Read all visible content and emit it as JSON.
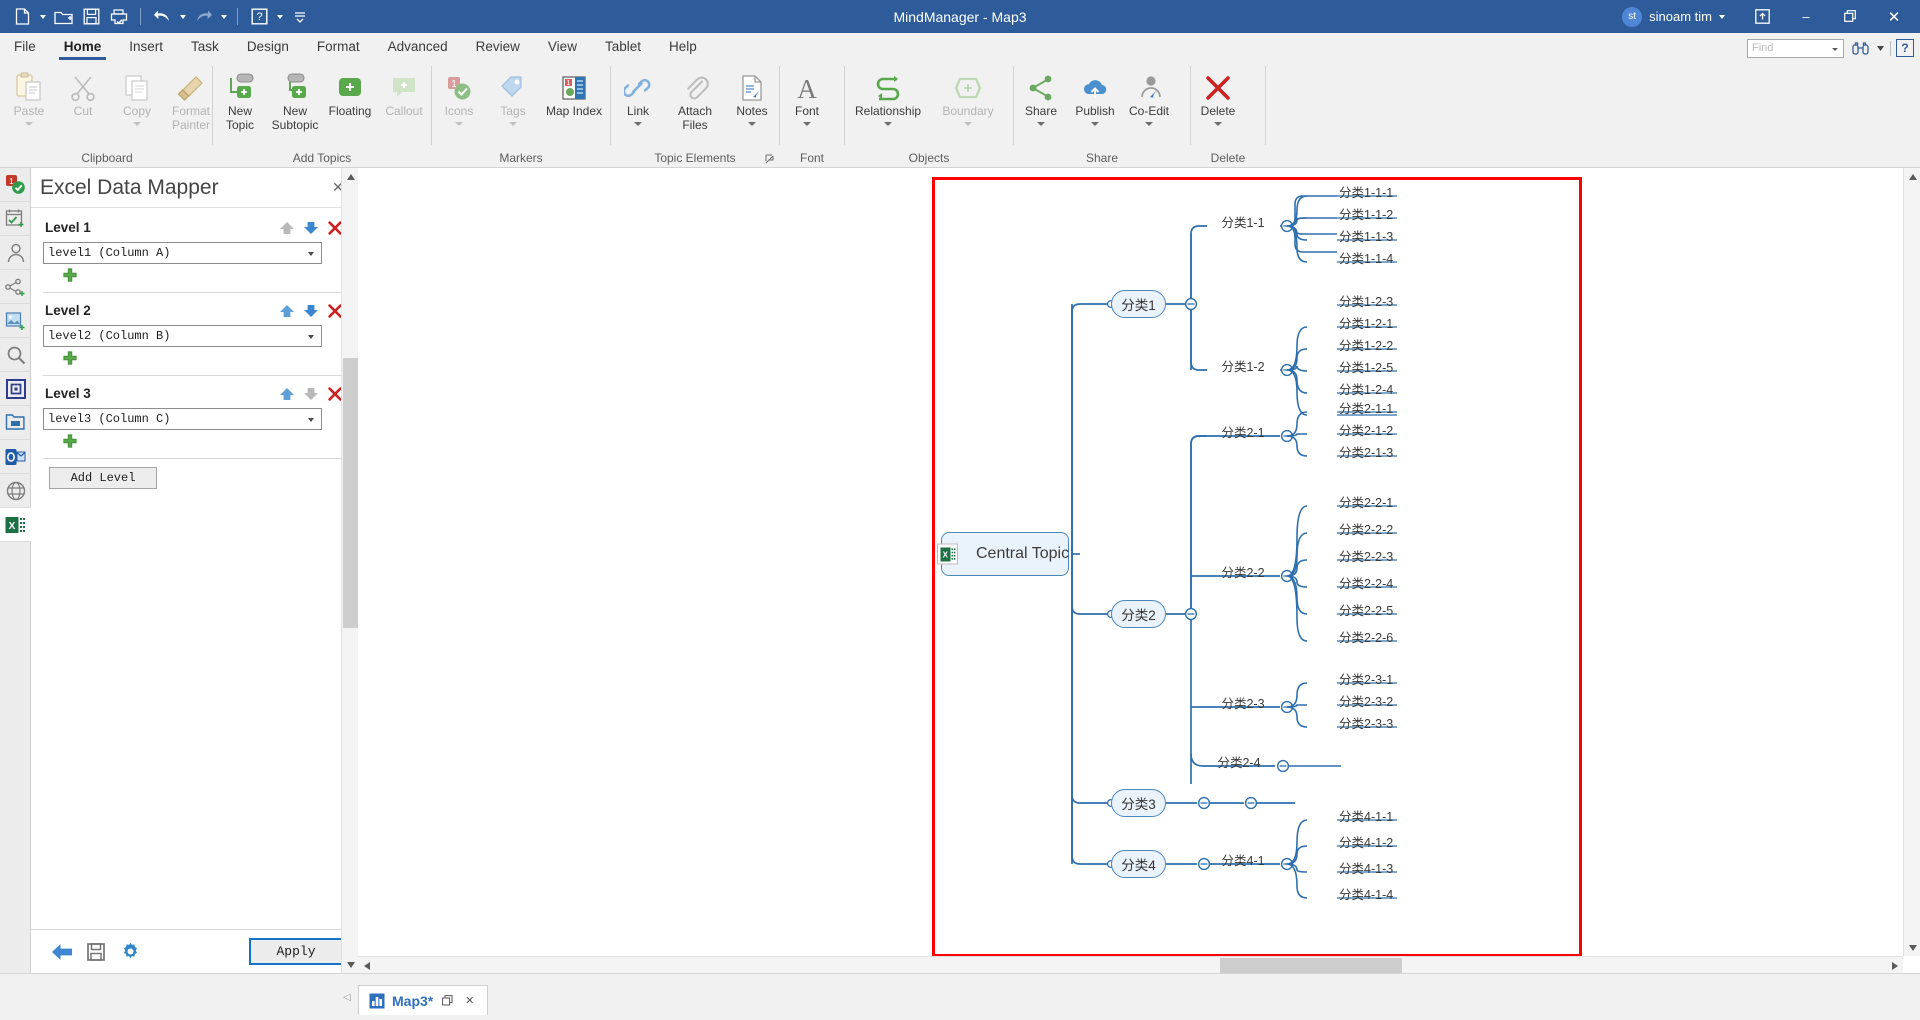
{
  "titlebar": {
    "app_title": "MindManager - Map3",
    "user_initials": "st",
    "user_name": "sinoam tim",
    "qat": [
      {
        "name": "new-document-icon",
        "label": "New"
      },
      {
        "name": "open-folder-icon",
        "label": "Open"
      },
      {
        "name": "save-icon",
        "label": "Save"
      },
      {
        "name": "print-preview-icon",
        "label": "Print Preview"
      },
      {
        "name": "undo-icon",
        "label": "Undo"
      },
      {
        "name": "redo-icon",
        "label": "Redo"
      },
      {
        "name": "help-icon",
        "label": "Help"
      }
    ],
    "window_controls": {
      "restore_ribbon": "⬒",
      "minimize": "–",
      "maximize": "❐",
      "close": "✕"
    }
  },
  "menubar": {
    "items": [
      {
        "label": "File",
        "active": false
      },
      {
        "label": "Home",
        "active": true
      },
      {
        "label": "Insert",
        "active": false
      },
      {
        "label": "Task",
        "active": false
      },
      {
        "label": "Design",
        "active": false
      },
      {
        "label": "Format",
        "active": false
      },
      {
        "label": "Advanced",
        "active": false
      },
      {
        "label": "Review",
        "active": false
      },
      {
        "label": "View",
        "active": false
      },
      {
        "label": "Tablet",
        "active": false
      },
      {
        "label": "Help",
        "active": false
      }
    ],
    "find_placeholder": "Find"
  },
  "ribbon": {
    "groups": [
      {
        "title": "Clipboard",
        "buttons": [
          {
            "label": "Paste",
            "icon": "paste-icon",
            "dim": true,
            "caret": true
          },
          {
            "label": "Cut",
            "icon": "cut-icon",
            "dim": true,
            "caret": false
          },
          {
            "label": "Copy",
            "icon": "copy-icon",
            "dim": true,
            "caret": true
          },
          {
            "label": "Format Painter",
            "icon": "format-painter-icon",
            "dim": true,
            "caret": true
          }
        ]
      },
      {
        "title": "Add Topics",
        "buttons": [
          {
            "label": "New Topic",
            "icon": "new-topic-icon",
            "dim": false,
            "caret": true
          },
          {
            "label": "New Subtopic",
            "icon": "new-subtopic-icon",
            "dim": false,
            "caret": false
          },
          {
            "label": "Floating",
            "icon": "floating-topic-icon",
            "dim": false,
            "caret": false
          },
          {
            "label": "Callout",
            "icon": "callout-icon",
            "dim": true,
            "caret": false
          }
        ]
      },
      {
        "title": "Markers",
        "buttons": [
          {
            "label": "Icons",
            "icon": "icons-marker-icon",
            "dim": true,
            "caret": true
          },
          {
            "label": "Tags",
            "icon": "tags-icon",
            "dim": true,
            "caret": true
          },
          {
            "label": "Map Index",
            "icon": "map-index-icon",
            "dim": false,
            "caret": true
          }
        ]
      },
      {
        "title": "Topic Elements",
        "buttons": [
          {
            "label": "Link",
            "icon": "link-icon",
            "dim": false,
            "caret": true
          },
          {
            "label": "Attach Files",
            "icon": "attach-files-icon",
            "dim": false,
            "caret": true
          },
          {
            "label": "Notes",
            "icon": "notes-icon",
            "dim": false,
            "caret": true
          }
        ],
        "launcher": true
      },
      {
        "title": "Font",
        "buttons": [
          {
            "label": "Font",
            "icon": "font-icon",
            "dim": false,
            "caret": true
          }
        ]
      },
      {
        "title": "Objects",
        "buttons": [
          {
            "label": "Relationship",
            "icon": "relationship-icon",
            "dim": false,
            "caret": true
          },
          {
            "label": "Boundary",
            "icon": "boundary-icon",
            "dim": true,
            "caret": true
          }
        ]
      },
      {
        "title": "Share",
        "buttons": [
          {
            "label": "Share",
            "icon": "share-icon",
            "dim": false,
            "caret": true
          },
          {
            "label": "Publish",
            "icon": "publish-icon",
            "dim": false,
            "caret": true
          },
          {
            "label": "Co-Edit",
            "icon": "co-edit-icon",
            "dim": false,
            "caret": true
          }
        ]
      },
      {
        "title": "Delete",
        "buttons": [
          {
            "label": "Delete",
            "icon": "delete-icon",
            "dim": false,
            "caret": true
          }
        ]
      }
    ]
  },
  "rail": {
    "items": [
      {
        "name": "sidebar-icon-markers",
        "label": "Markers"
      },
      {
        "name": "sidebar-icon-tasks",
        "label": "Task Info"
      },
      {
        "name": "sidebar-icon-resources",
        "label": "Resources"
      },
      {
        "name": "sidebar-icon-topic-parts",
        "label": "Topic Parts"
      },
      {
        "name": "sidebar-icon-images",
        "label": "Images"
      },
      {
        "name": "sidebar-icon-search",
        "label": "Search"
      },
      {
        "name": "sidebar-icon-map-parts",
        "label": "Map Parts"
      },
      {
        "name": "sidebar-icon-library",
        "label": "Library"
      },
      {
        "name": "sidebar-icon-outlook",
        "label": "Outlook"
      },
      {
        "name": "sidebar-icon-web",
        "label": "Web"
      },
      {
        "name": "sidebar-icon-excel-data-mapper",
        "label": "Excel Data Mapper"
      }
    ]
  },
  "panel": {
    "title": "Excel Data Mapper",
    "close_glyph": "✕",
    "levels": [
      {
        "name": "Level 1",
        "value": "level1 (Column A)",
        "up_enabled": false,
        "down_enabled": true
      },
      {
        "name": "Level 2",
        "value": "level2 (Column B)",
        "up_enabled": true,
        "down_enabled": true
      },
      {
        "name": "Level 3",
        "value": "level3 (Column C)",
        "up_enabled": true,
        "down_enabled": false
      }
    ],
    "add_level_label": "Add Level",
    "apply_label": "Apply",
    "footer_icons": [
      {
        "name": "back-arrow-icon",
        "label": "Back"
      },
      {
        "name": "save-icon",
        "label": "Save"
      },
      {
        "name": "settings-gear-icon",
        "label": "Settings"
      }
    ]
  },
  "map": {
    "central": {
      "label": "Central Topic"
    },
    "branches": [
      {
        "label": "分类1"
      },
      {
        "label": "分类2"
      },
      {
        "label": "分类3"
      },
      {
        "label": "分类4"
      }
    ],
    "subs": [
      {
        "label": "分类1-1"
      },
      {
        "label": "分类1-2"
      },
      {
        "label": "分类2-1"
      },
      {
        "label": "分类2-2"
      },
      {
        "label": "分类2-3"
      },
      {
        "label": "分类2-4"
      },
      {
        "label": "分类4-1"
      }
    ],
    "leaves": [
      {
        "label": "分类1-1-1"
      },
      {
        "label": "分类1-1-2"
      },
      {
        "label": "分类1-1-3"
      },
      {
        "label": "分类1-1-4"
      },
      {
        "label": "分类1-2-3"
      },
      {
        "label": "分类1-2-1"
      },
      {
        "label": "分类1-2-2"
      },
      {
        "label": "分类1-2-5"
      },
      {
        "label": "分类1-2-4"
      },
      {
        "label": "分类2-1-1"
      },
      {
        "label": "分类2-1-2"
      },
      {
        "label": "分类2-1-3"
      },
      {
        "label": "分类2-2-1"
      },
      {
        "label": "分类2-2-2"
      },
      {
        "label": "分类2-2-3"
      },
      {
        "label": "分类2-2-4"
      },
      {
        "label": "分类2-2-5"
      },
      {
        "label": "分类2-2-6"
      },
      {
        "label": "分类2-3-1"
      },
      {
        "label": "分类2-3-2"
      },
      {
        "label": "分类2-3-3"
      },
      {
        "label": "分类4-1-1"
      },
      {
        "label": "分类4-1-2"
      },
      {
        "label": "分类4-1-3"
      },
      {
        "label": "分类4-1-4"
      }
    ],
    "selection_color": "#ff0000",
    "branch_color": "#2e6fae"
  },
  "statusbar": {
    "doc_tab": "Map3*",
    "tab_restore_glyph": "❐",
    "tab_close_glyph": "✕",
    "prev_glyph": "◁"
  }
}
